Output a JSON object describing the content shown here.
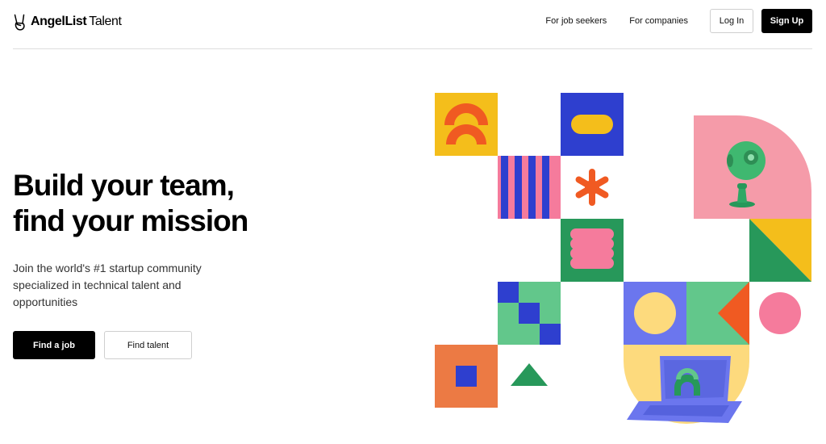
{
  "header": {
    "logo": {
      "brand": "AngelList",
      "product": "Talent",
      "icon": "victory-hand-icon"
    },
    "nav": {
      "job_seekers": "For job seekers",
      "companies": "For companies",
      "login": "Log In",
      "signup": "Sign Up"
    }
  },
  "hero": {
    "title_line1": "Build your team,",
    "title_line2": "find your mission",
    "subtitle": "Join the world's #1 startup community specialized in technical talent and opportunities",
    "primary_cta": "Find a job",
    "secondary_cta": "Find talent"
  },
  "illustration": {
    "icons": [
      "webcam-icon",
      "laptop-icon",
      "asterisk-shape",
      "triangle-shape",
      "circle-shape",
      "square-shape"
    ],
    "colors": {
      "yellow": "#F4BE1B",
      "orange": "#F05A22",
      "pink": "#F57B9C",
      "light_pink": "#F59BA9",
      "blue": "#2E3FCF",
      "periwinkle": "#6B76EE",
      "green": "#27985A",
      "light_green": "#62C78B",
      "pale_yellow": "#FDDA7D",
      "terracotta": "#EC7A44"
    }
  }
}
